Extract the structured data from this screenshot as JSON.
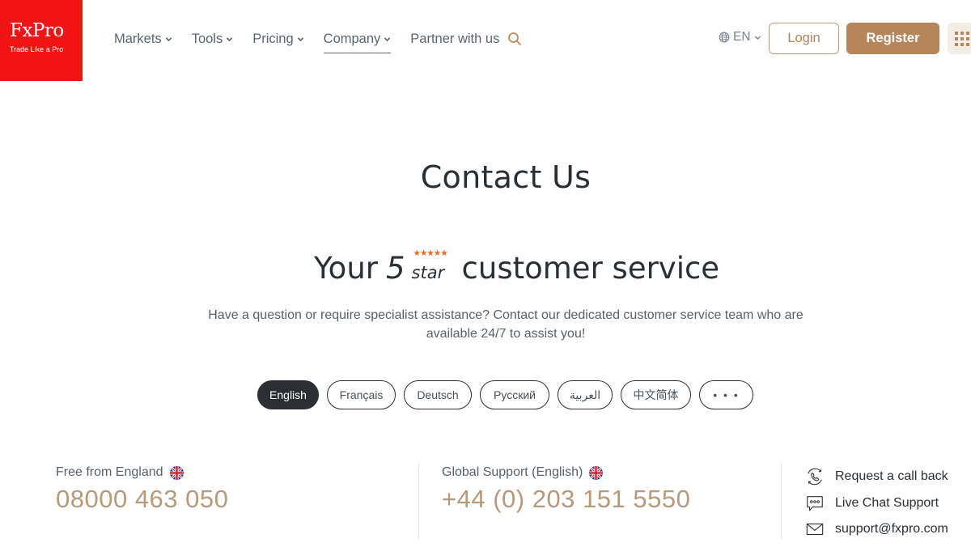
{
  "brand": {
    "name": "FxPro",
    "tagline": "Trade Like a Pro",
    "color": "#f01414",
    "accent": "#b7855a"
  },
  "nav": {
    "items": [
      {
        "label": "Markets",
        "has_dropdown": true,
        "active": false
      },
      {
        "label": "Tools",
        "has_dropdown": true,
        "active": false
      },
      {
        "label": "Pricing",
        "has_dropdown": true,
        "active": false
      },
      {
        "label": "Company",
        "has_dropdown": true,
        "active": true
      },
      {
        "label": "Partner with us",
        "has_dropdown": false,
        "active": false
      }
    ],
    "search_icon": "search-icon",
    "language": "EN",
    "login_label": "Login",
    "register_label": "Register",
    "apps_icon": "grid-icon"
  },
  "hero": {
    "title": "Contact Us",
    "tagline_prefix": "Your",
    "tagline_number": "5",
    "tagline_stars": "★★★★★",
    "tagline_star_word": "star",
    "tagline_suffix": "customer service",
    "lead": "Have a question or require specialist assistance? Contact our dedicated customer service team who are available 24/7 to assist you!"
  },
  "language_tabs": [
    {
      "label": "English",
      "active": true
    },
    {
      "label": "Français",
      "active": false
    },
    {
      "label": "Deutsch",
      "active": false
    },
    {
      "label": "Русский",
      "active": false
    },
    {
      "label": "العربية",
      "active": false
    },
    {
      "label": "中文简体",
      "active": false
    },
    {
      "label": "• • •",
      "active": false
    }
  ],
  "contacts": [
    {
      "label": "Free from England",
      "flag": "uk-flag-icon",
      "number": "08000 463 050"
    },
    {
      "label": "Global Support (English)",
      "flag": "uk-flag-icon",
      "number": "+44 (0) 203 151 5550"
    }
  ],
  "side_links": [
    {
      "label": "Request a call back",
      "icon": "phone-callback-icon"
    },
    {
      "label": "Live Chat Support",
      "icon": "chat-bubble-icon"
    },
    {
      "label": "support@fxpro.com",
      "icon": "envelope-icon"
    }
  ]
}
